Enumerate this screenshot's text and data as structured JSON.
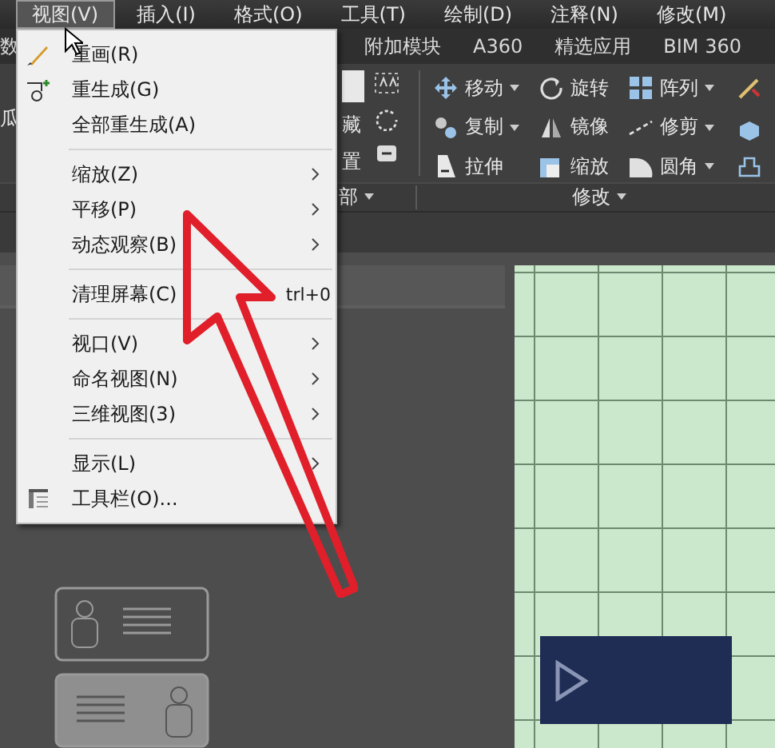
{
  "menu_bar": [
    {
      "label": "视图(V)",
      "selected": true
    },
    {
      "label": "插入(I)",
      "selected": false
    },
    {
      "label": "格式(O)",
      "selected": false
    },
    {
      "label": "工具(T)",
      "selected": false
    },
    {
      "label": "绘制(D)",
      "selected": false
    },
    {
      "label": "注释(N)",
      "selected": false
    },
    {
      "label": "修改(M)",
      "selected": false
    }
  ],
  "ribbon_tabs": [
    {
      "label": "数"
    },
    {
      "label": "附加模块"
    },
    {
      "label": "A360"
    },
    {
      "label": "精选应用"
    },
    {
      "label": "BIM 360"
    }
  ],
  "ribbon_left": {
    "labels": [
      "藏",
      "置"
    ],
    "panel_label": "部"
  },
  "modify_panel": {
    "title": "修改",
    "rows": [
      [
        {
          "label": "移动",
          "dropdown": true
        },
        {
          "label": "旋转",
          "dropdown": false
        },
        {
          "label": "阵列",
          "dropdown": true
        }
      ],
      [
        {
          "label": "复制",
          "dropdown": true
        },
        {
          "label": "镜像",
          "dropdown": false
        },
        {
          "label": "修剪",
          "dropdown": true
        }
      ],
      [
        {
          "label": "拉伸",
          "dropdown": false
        },
        {
          "label": "缩放",
          "dropdown": false
        },
        {
          "label": "圆角",
          "dropdown": true
        }
      ]
    ]
  },
  "side_labels": [
    "瓜"
  ],
  "view_menu": [
    {
      "kind": "item",
      "label": "重画(R)",
      "submenu": false
    },
    {
      "kind": "item",
      "label": "重生成(G)",
      "submenu": false
    },
    {
      "kind": "item",
      "label": "全部重生成(A)",
      "submenu": false
    },
    {
      "kind": "separator"
    },
    {
      "kind": "item",
      "label": "缩放(Z)",
      "submenu": true
    },
    {
      "kind": "item",
      "label": "平移(P)",
      "submenu": true
    },
    {
      "kind": "item",
      "label": "动态观察(B)",
      "submenu": true
    },
    {
      "kind": "separator"
    },
    {
      "kind": "item",
      "label": "清理屏幕(C)",
      "shortcut": "trl+0",
      "submenu": false
    },
    {
      "kind": "separator"
    },
    {
      "kind": "item",
      "label": "视口(V)",
      "submenu": true
    },
    {
      "kind": "item",
      "label": "命名视图(N)",
      "submenu": true
    },
    {
      "kind": "item",
      "label": "三维视图(3)",
      "submenu": true
    },
    {
      "kind": "separator"
    },
    {
      "kind": "item",
      "label": "显示(L)",
      "submenu": true
    },
    {
      "kind": "item",
      "label": "工具栏(O)...",
      "submenu": false
    }
  ]
}
